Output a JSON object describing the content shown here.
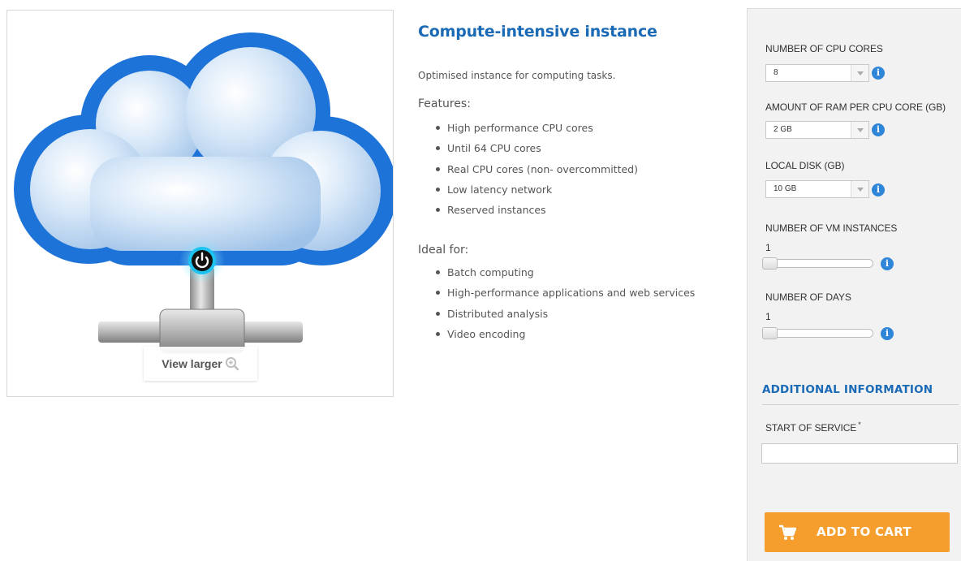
{
  "product": {
    "title": "Compute-intensive instance",
    "summary": "Optimised instance for computing tasks.",
    "features_heading": "Features:",
    "features": [
      "High performance CPU cores",
      "Until 64 CPU cores",
      "Real CPU cores (non- overcommitted)",
      "Low latency network",
      "Reserved instances"
    ],
    "ideal_heading": "Ideal for:",
    "ideal_for": [
      "Batch computing",
      "High-performance applications and web services",
      "Distributed analysis",
      "Video encoding"
    ]
  },
  "image": {
    "view_larger_label": "View larger",
    "icons": [
      "cloud-server-image",
      "power-icon",
      "zoom-in-icon"
    ],
    "colors": {
      "cloud": "#1e73d8",
      "cloud_inner": "#cfe3f7",
      "power_glow": "#1cc3f0"
    }
  },
  "options": {
    "cpu_cores": {
      "label": "NUMBER OF CPU CORES",
      "value": "8"
    },
    "ram_per_core": {
      "label": "AMOUNT OF RAM PER CPU CORE (GB)",
      "value": "2 GB"
    },
    "local_disk": {
      "label": "LOCAL DISK (GB)",
      "value": "10 GB"
    },
    "vm_instances": {
      "label": "NUMBER OF VM INSTANCES",
      "value": "1",
      "level": 0
    },
    "days": {
      "label": "NUMBER OF DAYS",
      "value": "1",
      "level": 0
    }
  },
  "additional": {
    "title": "ADDITIONAL INFORMATION",
    "start_label": "START OF SERVICE",
    "required_mark": "*",
    "start_value": ""
  },
  "cart": {
    "label": "ADD TO CART",
    "icon": "cart-icon"
  },
  "colors": {
    "accent": "#1a6ab6",
    "button": "#f59d2d",
    "info": "#2f85d8",
    "sidebar_bg": "#f2f2f2"
  }
}
